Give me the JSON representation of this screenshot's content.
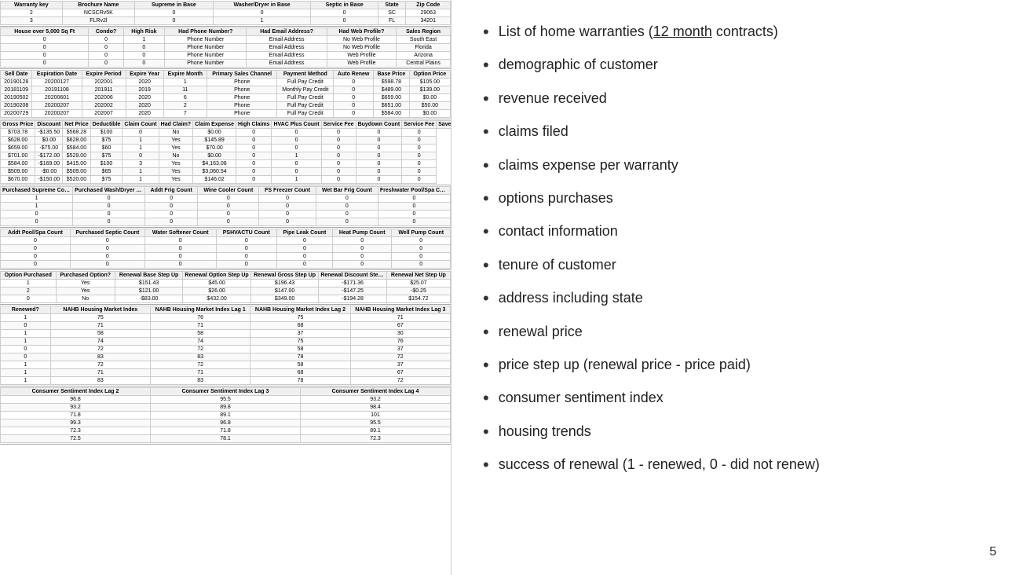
{
  "spreadsheet": {
    "section1": {
      "headers": [
        "Warranty key",
        "Brochure Name",
        "Supreme in Base",
        "Washer/Dryer in Base",
        "Septic in Base",
        "State",
        "Zip Code"
      ],
      "rows": [
        [
          "2",
          "NCSCRv5K",
          "0",
          "0",
          "0",
          "SC",
          "29063"
        ],
        [
          "3",
          "FLRv2l",
          "0",
          "1",
          "0",
          "FL",
          "34201"
        ]
      ]
    },
    "section2": {
      "headers": [
        "House over 5,000 Sq Ft",
        "Condo?",
        "High Risk",
        "Had Phone Number?",
        "Had Email Address?",
        "Had Web Profile?",
        "Sales Region"
      ],
      "rows": [
        [
          "0",
          "0",
          "1",
          "Phone Number",
          "Email Address",
          "No Web Profile",
          "South East"
        ],
        [
          "0",
          "0",
          "0",
          "Phone Number",
          "Email Address",
          "No Web Profile",
          "Florida"
        ],
        [
          "0",
          "0",
          "0",
          "Phone Number",
          "Email Address",
          "Web Profile",
          "Arizona"
        ],
        [
          "0",
          "0",
          "0",
          "Phone Number",
          "Email Address",
          "Web Profile",
          "Central Plains"
        ]
      ]
    },
    "section3": {
      "headers": [
        "Sell Date",
        "Expiration Date",
        "Expire Period",
        "Expire Year",
        "Expire Month",
        "Primary Sales Channel",
        "Payment Method",
        "Auto Renew",
        "Base Price",
        "Option Price"
      ],
      "rows": [
        [
          "20190128",
          "20200127",
          "202001",
          "2020",
          "1",
          "Phone",
          "Full Pay Credit",
          "0",
          "$598.78",
          "$105.00"
        ],
        [
          "20181109",
          "20191108",
          "201911",
          "2019",
          "11",
          "Phone",
          "Monthly Pay Credit",
          "0",
          "$489.00",
          "$139.00"
        ],
        [
          "20190502",
          "20200601",
          "202006",
          "2020",
          "6",
          "Phone",
          "Full Pay Credit",
          "0",
          "$659.00",
          "$0.00"
        ],
        [
          "20190208",
          "20200207",
          "202002",
          "2020",
          "2",
          "Phone",
          "Full Pay Credit",
          "0",
          "$651.00",
          "$50.00"
        ],
        [
          "20200729",
          "20200207",
          "202007",
          "2020",
          "7",
          "Phone",
          "Full Pay Credit",
          "0",
          "$584.00",
          "$0.00"
        ]
      ]
    },
    "section4": {
      "headers": [
        "Gross Price",
        "Discount",
        "Net Price",
        "Deductible",
        "Claim Count",
        "Had Claim?",
        "Claim Expense",
        "High Claims",
        "HVAC Plus Count",
        "Service Fee",
        "Buydown Count",
        "Service Fee",
        "Saveup Count"
      ],
      "rows": [
        [
          "$703.78",
          "-$135.50",
          "$568.28",
          "$100",
          "0",
          "No",
          "$0.00",
          "0",
          "0",
          "0",
          "0",
          "0"
        ],
        [
          "$628.00",
          "$0.00",
          "$628.00",
          "$75",
          "1",
          "Yes",
          "$145.89",
          "0",
          "0",
          "0",
          "0",
          "0"
        ],
        [
          "$659.00",
          "-$75.00",
          "$584.00",
          "$60",
          "1",
          "Yes",
          "$70.00",
          "0",
          "0",
          "0",
          "0",
          "0"
        ],
        [
          "$701.00",
          "-$172.00",
          "$529.00",
          "$75",
          "0",
          "No",
          "$0.00",
          "0",
          "1",
          "0",
          "0",
          "0"
        ],
        [
          "$584.00",
          "-$169.00",
          "$415.00",
          "$100",
          "3",
          "Yes",
          "$4,163.08",
          "0",
          "0",
          "0",
          "0",
          "0"
        ],
        [
          "$509.00",
          "-$0.00",
          "$509.00",
          "$65",
          "1",
          "Yes",
          "$3,060.54",
          "0",
          "0",
          "0",
          "0",
          "0"
        ],
        [
          "$670.00",
          "-$150.00",
          "$520.00",
          "$75",
          "1",
          "Yes",
          "$146.02",
          "0",
          "1",
          "0",
          "0",
          "0"
        ]
      ]
    },
    "section5": {
      "headers": [
        "Purchased Supreme Count",
        "Purchased Wash/Dryer Count",
        "Addt Frig Count",
        "Wine Cooler Count",
        "FS Freezer Count",
        "Wet Bar Frig Count",
        "Freshwater Pool/Spa Count"
      ],
      "rows": [
        [
          "1",
          "0",
          "0",
          "0",
          "0",
          "0",
          "0"
        ],
        [
          "1",
          "0",
          "0",
          "0",
          "0",
          "0",
          "0"
        ],
        [
          "0",
          "0",
          "0",
          "0",
          "0",
          "0",
          "0"
        ],
        [
          "0",
          "0",
          "0",
          "0",
          "0",
          "0",
          "0"
        ]
      ]
    },
    "section6": {
      "headers": [
        "Addt Pool/Spa Count",
        "Purchased Septic Count",
        "Water Softener Count",
        "PSHVACTU Count",
        "Pipe Leak Count",
        "Heat Pump Count",
        "Well Pump Count"
      ],
      "rows": [
        [
          "0",
          "0",
          "0",
          "0",
          "0",
          "0",
          "0"
        ],
        [
          "0",
          "0",
          "0",
          "0",
          "0",
          "0",
          "0"
        ],
        [
          "0",
          "0",
          "0",
          "0",
          "0",
          "0",
          "0"
        ],
        [
          "0",
          "0",
          "0",
          "0",
          "0",
          "0",
          "0"
        ]
      ]
    },
    "section7": {
      "headers": [
        "Option Purchased",
        "Purchased Option?",
        "Renewal Base Step Up",
        "Renewal Option Step Up",
        "Renewal Gross Step Up",
        "Renewal Discount Step Up",
        "Renewal Net Step Up"
      ],
      "rows": [
        [
          "1",
          "Yes",
          "$151.43",
          "$45.00",
          "$196.43",
          "-$171.36",
          "$25.07"
        ],
        [
          "2",
          "Yes",
          "$121.00",
          "$26.00",
          "$147.00",
          "-$147.25",
          "-$0.25"
        ],
        [
          "0",
          "No",
          "-$83.00",
          "$432.00",
          "$349.00",
          "-$194.28",
          "$154.72"
        ]
      ]
    },
    "section8": {
      "headers": [
        "Renewed?",
        "NAHB Housing Market Index",
        "NAHB Housing Market Index Lag 1",
        "NAHB Housing Market Index Lag 2",
        "NAHB Housing Market Index Lag 3"
      ],
      "rows": [
        [
          "1",
          "75",
          "76",
          "75",
          "71"
        ],
        [
          "0",
          "71",
          "71",
          "68",
          "67"
        ],
        [
          "1",
          "58",
          "58",
          "37",
          "30"
        ],
        [
          "1",
          "74",
          "74",
          "75",
          "76"
        ],
        [
          "0",
          "72",
          "72",
          "58",
          "37"
        ],
        [
          "0",
          "83",
          "83",
          "78",
          "72"
        ],
        [
          "1",
          "72",
          "72",
          "58",
          "37"
        ],
        [
          "1",
          "71",
          "71",
          "68",
          "67"
        ],
        [
          "1",
          "83",
          "83",
          "78",
          "72"
        ]
      ]
    },
    "section9": {
      "headers": [
        "Consumer Sentiment Index Lag 2",
        "Consumer Sentiment Index Lag 3",
        "Consumer Sentiment Index Lag 4"
      ],
      "rows": [
        [
          "96.8",
          "95.5",
          "93.2"
        ],
        [
          "93.2",
          "89.8",
          "98.4"
        ],
        [
          "71.8",
          "89.1",
          "101"
        ],
        [
          "99.3",
          "96.8",
          "95.5"
        ],
        [
          "72.3",
          "71.8",
          "89.1"
        ],
        [
          "72.5",
          "78.1",
          "72.3"
        ]
      ]
    }
  },
  "bullets": [
    {
      "id": "home-warranties",
      "text": "List of home warranties (",
      "highlight": "12 month",
      "textAfter": " contracts)"
    },
    {
      "id": "demographic",
      "text": "demographic of customer"
    },
    {
      "id": "revenue",
      "text": "revenue received"
    },
    {
      "id": "claims-filed",
      "text": "claims filed"
    },
    {
      "id": "claims-expense",
      "text": "claims expense per warranty"
    },
    {
      "id": "options-purchases",
      "text": "options purchases"
    },
    {
      "id": "contact-info",
      "text": "contact information"
    },
    {
      "id": "tenure",
      "text": "tenure of customer"
    },
    {
      "id": "address",
      "text": "address including state"
    },
    {
      "id": "renewal-price",
      "text": "renewal price"
    },
    {
      "id": "price-step-up",
      "text": "price step up (renewal price -  price paid)"
    },
    {
      "id": "consumer-sentiment",
      "text": "consumer sentiment index"
    },
    {
      "id": "housing-trends",
      "text": "housing trends"
    },
    {
      "id": "success-renewal",
      "text": "success of renewal (1 - renewed, 0 - did not renew)"
    }
  ],
  "page_number": "5"
}
